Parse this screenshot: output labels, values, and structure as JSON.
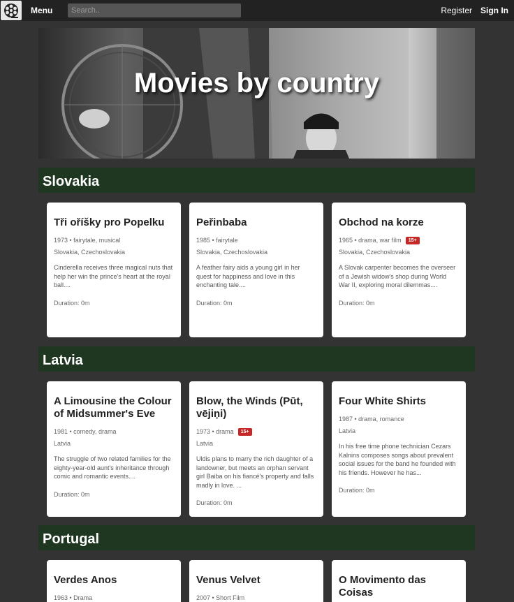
{
  "nav": {
    "menu_label": "Menu",
    "search_placeholder": "Search..",
    "register_label": "Register",
    "signin_label": "Sign In"
  },
  "hero": {
    "title": "Movies by country"
  },
  "sections": [
    {
      "country": "Slovakia",
      "movies": [
        {
          "title": "Tři oříšky pro Popelku",
          "meta": "1973 • fairytale, musical",
          "badge": "",
          "country": "Slovakia, Czechoslovakia",
          "description": "Cinderella receives three magical nuts that help her win the prince's heart at the royal ball....",
          "duration": "Duration: 0m"
        },
        {
          "title": "Peřinbaba",
          "meta": "1985 • fairytale",
          "badge": "",
          "country": "Slovakia, Czechoslovakia",
          "description": "A feather fairy aids a young girl in her quest for happiness and love in this enchanting tale....",
          "duration": "Duration: 0m"
        },
        {
          "title": "Obchod na korze",
          "meta": "1965 • drama, war film",
          "badge": "15+",
          "country": "Slovakia, Czechoslovakia",
          "description": "A Slovak carpenter becomes the overseer of a Jewish widow's shop during World War II, exploring moral dilemmas....",
          "duration": "Duration: 0m"
        }
      ]
    },
    {
      "country": "Latvia",
      "movies": [
        {
          "title": "A Limousine the Colour of Midsummer's Eve",
          "meta": "1981 • comedy, drama",
          "badge": "",
          "country": "Latvia",
          "description": "The struggle of two related families for the eighty-year-old aunt's inheritance through comic and romantic events....",
          "duration": "Duration: 0m"
        },
        {
          "title": "Blow, the Winds (Pūt, vējiņi)",
          "meta": "1973 • drama",
          "badge": "15+",
          "country": "Latvia",
          "description": "Uldis plans to marry the rich daughter of a landowner, but meets an orphan servant girl Baiba on his fiancé's property and falls madly in love. ...",
          "duration": "Duration: 0m"
        },
        {
          "title": "Four White Shirts",
          "meta": "1987 • drama, romance",
          "badge": "",
          "country": "Latvia",
          "description": "In his free time phone technician Cezars Kalnins composes songs about prevalent social issues for the band he founded with his friends. However he has...",
          "duration": "Duration: 0m"
        }
      ]
    },
    {
      "country": "Portugal",
      "movies": [
        {
          "title": "Verdes Anos",
          "meta": "1963 • Drama",
          "badge": "",
          "country": "",
          "description": "",
          "duration": ""
        },
        {
          "title": "Venus Velvet",
          "meta": "2007 • Short Film",
          "badge": "",
          "country": "",
          "description": "",
          "duration": ""
        },
        {
          "title": "O Movimento das Coisas",
          "meta": "",
          "badge": "",
          "country": "",
          "description": "",
          "duration": ""
        }
      ]
    }
  ]
}
